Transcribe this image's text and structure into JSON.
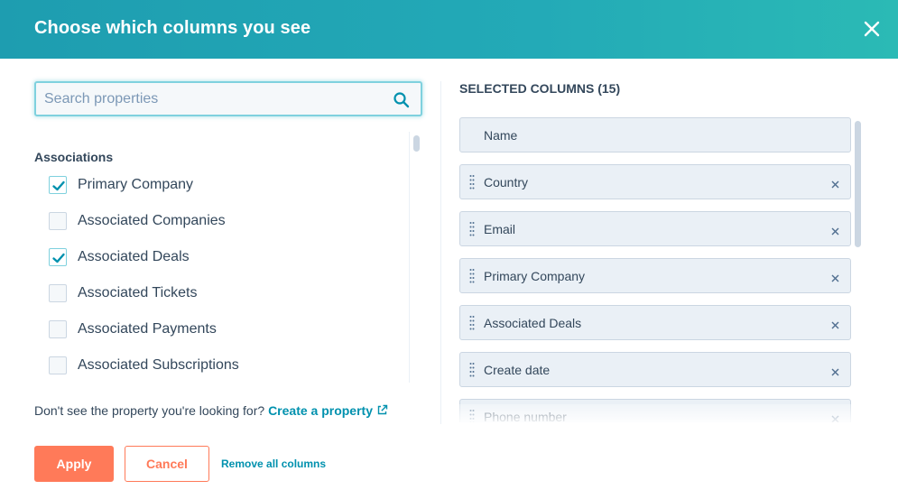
{
  "header": {
    "title": "Choose which columns you see",
    "close_icon": "close-icon"
  },
  "search": {
    "placeholder": "Search properties",
    "value": ""
  },
  "properties": {
    "group_label": "Associations",
    "items": [
      {
        "label": "Primary Company",
        "checked": true
      },
      {
        "label": "Associated Companies",
        "checked": false
      },
      {
        "label": "Associated Deals",
        "checked": true
      },
      {
        "label": "Associated Tickets",
        "checked": false
      },
      {
        "label": "Associated Payments",
        "checked": false
      },
      {
        "label": "Associated Subscriptions",
        "checked": false
      }
    ]
  },
  "help": {
    "text": "Don't see the property you're looking for?",
    "link_label": "Create a property"
  },
  "selected": {
    "title": "SELECTED COLUMNS (15)",
    "columns": [
      {
        "label": "Name",
        "removable": false
      },
      {
        "label": "Country",
        "removable": true
      },
      {
        "label": "Email",
        "removable": true
      },
      {
        "label": "Primary Company",
        "removable": true
      },
      {
        "label": "Associated Deals",
        "removable": true
      },
      {
        "label": "Create date",
        "removable": true
      },
      {
        "label": "Phone number",
        "removable": true
      }
    ]
  },
  "footer": {
    "apply_label": "Apply",
    "cancel_label": "Cancel",
    "remove_all_label": "Remove all columns"
  },
  "colors": {
    "header_teal": "#1e9db0",
    "accent_orange": "#ff7a59",
    "link_blue": "#0091ae",
    "text_dark": "#33475b",
    "chip_bg": "#eaf0f6"
  }
}
